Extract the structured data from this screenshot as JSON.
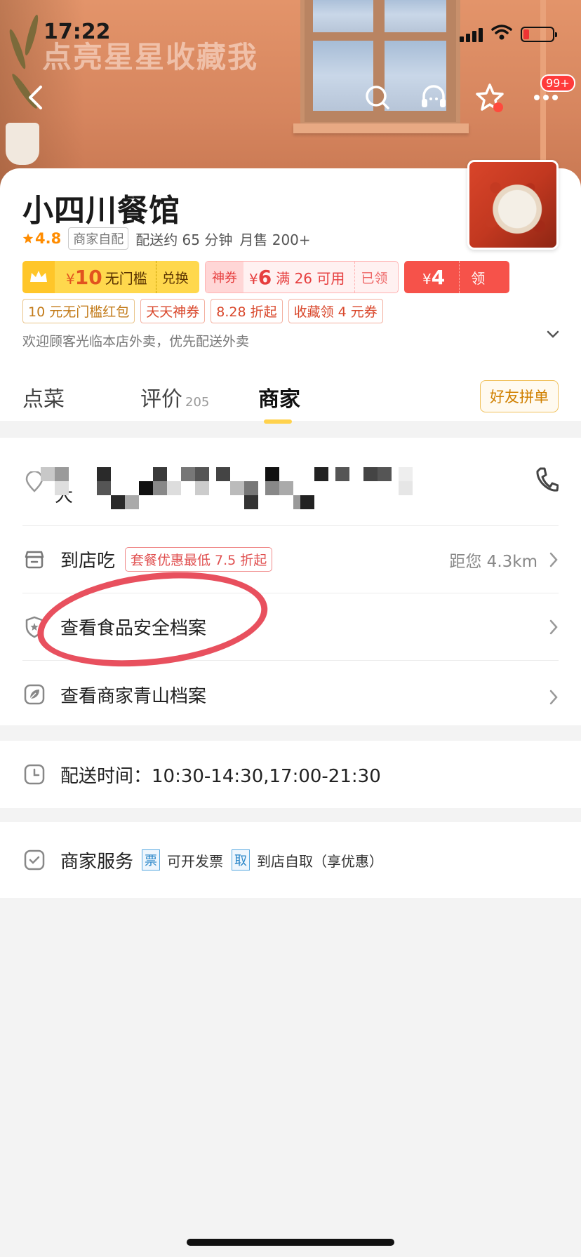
{
  "status_bar": {
    "time": "17:22"
  },
  "banner_text": "点亮星星收藏我",
  "header": {
    "notification_badge": "99+"
  },
  "store": {
    "name": "小四川餐馆",
    "rating": "4.8",
    "delivery_tag": "商家自配",
    "delivery_time": "配送约 65 分钟",
    "monthly_sales": "月售 200+",
    "notice": "欢迎顾客光临本店外卖，优先配送外卖"
  },
  "coupons": {
    "vip": {
      "currency": "¥",
      "amount": "10",
      "label": "无门槛",
      "action": "兑换"
    },
    "shen": {
      "tag": "神券",
      "currency": "¥",
      "amount": "6",
      "label": "满 26 可用",
      "action": "已领"
    },
    "red": {
      "currency": "¥",
      "amount": "4",
      "action": "领"
    }
  },
  "promo_tags": [
    "10 元无门槛红包",
    "天天神券",
    "8.28 折起",
    "收藏领 4 元券"
  ],
  "tabs": [
    {
      "label": "点菜"
    },
    {
      "label": "评价",
      "count": "205"
    },
    {
      "label": "商家"
    }
  ],
  "friend_button": "好友拼单",
  "info": {
    "address_first_char": "大",
    "dine_in": {
      "label": "到店吃",
      "tag": "套餐优惠最低 7.5 折起",
      "distance": "距您 4.3km"
    },
    "food_safety": "查看食品安全档案",
    "green_archive": "查看商家青山档案",
    "delivery_hours": "配送时间：10:30-14:30,17:00-21:30",
    "services": {
      "label": "商家服务",
      "items": [
        {
          "badge": "票",
          "text": "可开发票"
        },
        {
          "badge": "取",
          "text": "到店自取（享优惠）"
        }
      ]
    }
  },
  "colors": {
    "accent_yellow": "#ffd24d",
    "coupon_red": "#f6524a",
    "annotation_circle": "#e8505e"
  }
}
